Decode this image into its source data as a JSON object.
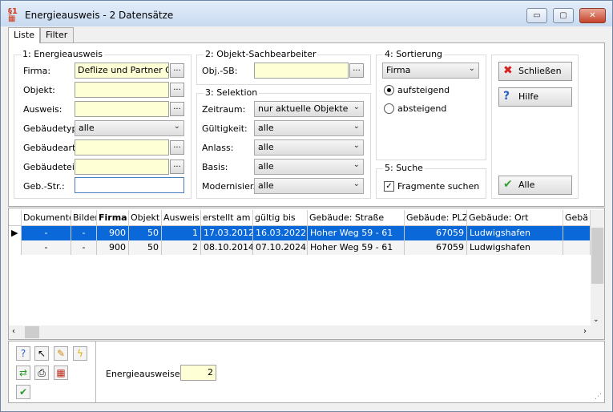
{
  "window": {
    "title": "Energieausweis - 2 Datensätze",
    "minimize": "▭",
    "maximize": "▢",
    "close": "✕"
  },
  "tabs": [
    "Liste",
    "Filter"
  ],
  "group1": {
    "legend": "1: Energieausweis",
    "labels": [
      "Firma:",
      "Objekt:",
      "Ausweis:",
      "Gebäudetyp:",
      "Gebäudeart:",
      "Gebäudeteil:",
      "Geb.-Str.:"
    ],
    "firma": "Deflize und Partner Gml",
    "objekt": "",
    "ausweis": "",
    "gebaeudetyp": "alle",
    "gebaeudeart": "",
    "gebaeudeteil": "",
    "gebstr": ""
  },
  "group2": {
    "legend": "2: Objekt-Sachbearbeiter",
    "label": "Obj.-SB:",
    "value": ""
  },
  "group3": {
    "legend": "3: Selektion",
    "labels": [
      "Zeitraum:",
      "Gültigkeit:",
      "Anlass:",
      "Basis:",
      "Modernisier.:"
    ],
    "values": [
      "nur aktuelle Objekte",
      "alle",
      "alle",
      "alle",
      "alle"
    ]
  },
  "group4": {
    "legend": "4: Sortierung",
    "value": "Firma",
    "asc": "aufsteigend",
    "desc": "absteigend"
  },
  "group5": {
    "legend": "5: Suche",
    "fragment": "Fragmente suchen"
  },
  "buttons": {
    "close": "Schließen",
    "help": "Hilfe",
    "all": "Alle",
    "dots": "..."
  },
  "grid": {
    "headers": [
      "Dokumente",
      "Bilder",
      "Firma",
      "Objekt",
      "Ausweis",
      "erstellt am",
      "gültig bis",
      "Gebäude: Straße",
      "Gebäude: PLZ",
      "Gebäude: Ort",
      "Gebä"
    ],
    "rows": [
      [
        "-",
        "-",
        "900",
        "50",
        "1",
        "17.03.2012",
        "16.03.2022",
        "Hoher Weg 59 - 61",
        "67059",
        "Ludwigshafen"
      ],
      [
        "-",
        "-",
        "900",
        "50",
        "2",
        "08.10.2014",
        "07.10.2024",
        "Hoher Weg 59 - 61",
        "67059",
        "Ludwigshafen"
      ]
    ]
  },
  "footer": {
    "label": "Energieausweise:",
    "count": "2"
  },
  "colors": {
    "selection": "#0a68d8",
    "field_bg": "#ffffd6"
  }
}
